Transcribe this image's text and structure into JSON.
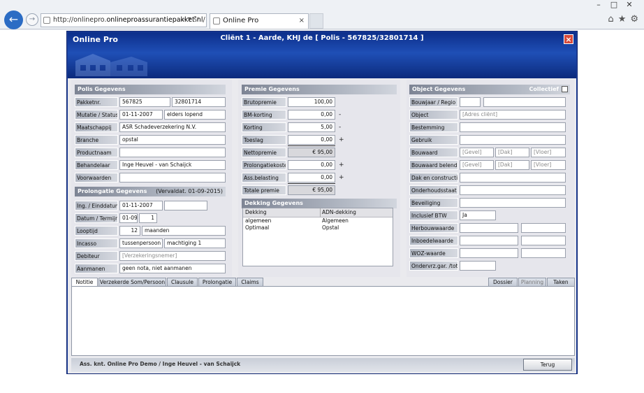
{
  "browser": {
    "url_prefix": "http://onlinepro.",
    "url_domain": "onlineproassurantiepakket.nl",
    "url_suffix": "/",
    "tab_title": "Online Pro"
  },
  "app": {
    "logo": "Online Pro",
    "title": "Cliënt 1  -  Aarde, KHJ de   [ Polis - 567825/32801714 ]"
  },
  "polis": {
    "title": "Polis Gegevens",
    "rows": [
      {
        "label": "Pakketnr.",
        "v1": "567825",
        "v2": "32801714"
      },
      {
        "label": "Mutatie / Status",
        "v1": "01-11-2007",
        "v2": "elders lopend"
      },
      {
        "label": "Maatschappij",
        "v1": "ASR Schadeverzekering N.V."
      },
      {
        "label": "Branche",
        "v1": "opstal"
      },
      {
        "label": "Productnaam",
        "v1": ""
      },
      {
        "label": "Behandelaar",
        "v1": "Inge Heuvel - van Schaijck"
      },
      {
        "label": "Voorwaarden",
        "v1": ""
      }
    ]
  },
  "prolongatie": {
    "title": "Prolongatie Gegevens",
    "vervaldat": "(Vervaldat. 01-09-2015)",
    "rows": [
      {
        "label": "Ing. / Einddatum",
        "v1": "01-11-2007",
        "v2": ""
      },
      {
        "label": "Datum / Termijn",
        "v1": "01-09",
        "v2": "1"
      },
      {
        "label": "Looptijd",
        "v1": "12",
        "v2": "maanden"
      },
      {
        "label": "Incasso",
        "v1": "tussenpersoon",
        "v2": "machtiging 1"
      },
      {
        "label": "Debiteur",
        "v1": "[Verzekeringsnemer]"
      },
      {
        "label": "Aanmanen",
        "v1": "geen nota, niet aanmanen"
      }
    ]
  },
  "premie": {
    "title": "Premie Gegevens",
    "rows": [
      {
        "label": "Brutopremie",
        "value": "100,00",
        "sign": ""
      },
      {
        "label": "BM-korting",
        "value": "0,00",
        "sign": "-"
      },
      {
        "label": "Korting",
        "value": "5,00",
        "sign": "-"
      },
      {
        "label": "Toeslag",
        "value": "0,00",
        "sign": "+"
      },
      {
        "label": "Nettopremie",
        "value": "€ 95,00",
        "sign": ""
      },
      {
        "label": "Prolongatiekosten",
        "value": "0,00",
        "sign": "+"
      },
      {
        "label": "Ass.belasting",
        "value": "0,00",
        "sign": "+"
      },
      {
        "label": "Totale premie",
        "value": "€ 95,00",
        "sign": ""
      }
    ]
  },
  "dekking": {
    "title": "Dekking Gegevens",
    "headers": [
      "Dekking",
      "ADN-dekking"
    ],
    "rows": [
      [
        "algemeen",
        "Algemeen"
      ],
      [
        "Optimaal",
        "Opstal"
      ]
    ]
  },
  "object": {
    "title": "Object Gegevens",
    "collectief": "Collectief",
    "bouwjaar": {
      "label": "Bouwjaar / Regio",
      "v1": "",
      "v2": ""
    },
    "object": {
      "label": "Object",
      "v1": "[Adres cliënt]"
    },
    "bestemming": {
      "label": "Bestemming",
      "v1": ""
    },
    "gebruik": {
      "label": "Gebruik",
      "v1": ""
    },
    "bouwaard": {
      "label": "Bouwaard",
      "v1": "[Gevel]",
      "v2": "[Dak]",
      "v3": "[Vloer]"
    },
    "bouwaard_belend": {
      "label": "Bouwaard belend.",
      "v1": "[Gevel]",
      "v2": "[Dak]",
      "v3": "[Vloer]"
    },
    "dak": {
      "label": "Dak en constructie",
      "v1": ""
    },
    "onderhoud": {
      "label": "Onderhoudsstaat",
      "v1": ""
    },
    "beveiliging": {
      "label": "Beveiliging",
      "v1": ""
    },
    "btw": {
      "label": "Inclusief BTW",
      "v1": "Ja"
    },
    "herbouw": {
      "label": "Herbouwwaarde",
      "v1": "",
      "v2": ""
    },
    "inboedel": {
      "label": "Inboedelwaarde",
      "v1": "",
      "v2": ""
    },
    "woz": {
      "label": "WOZ-waarde",
      "v1": "",
      "v2": ""
    },
    "ondervrz": {
      "label": "Ondervrz.gar. /tot",
      "v1": ""
    }
  },
  "tabs_left": [
    "Notitie",
    "Verzekerde Som/Persoon",
    "Clausule",
    "Prolongatie",
    "Claims"
  ],
  "tabs_right": [
    "Dossier",
    "Planning",
    "Taken"
  ],
  "footer": {
    "text": "Ass. knt. Online Pro Demo / Inge Heuvel - van Schaijck",
    "back_button": "Terug"
  }
}
